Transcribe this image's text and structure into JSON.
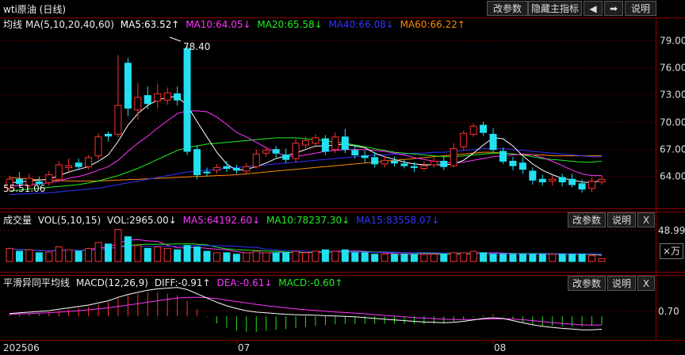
{
  "window": {
    "title": "wti原油 (日线)",
    "toolbar": {
      "params_label": "改参数",
      "hide_indicator_label": "隐藏主指标",
      "back_label": "◀",
      "forward_label": "➡",
      "help_label": "说明"
    }
  },
  "main_panel": {
    "legend": {
      "name": "均线",
      "config": "MA(5,10,20,40,60)",
      "ma5": "MA5:63.52↑",
      "ma10": "MA10:64.05↓",
      "ma20": "MA20:65.58↓",
      "ma40": "MA40:66.08↓",
      "ma60": "MA60:66.22↑"
    },
    "y_ticks": [
      "79.00",
      "76.00",
      "73.00",
      "70.00",
      "67.00",
      "64.00"
    ],
    "high_label": "78.40",
    "low_label": "55.51.06"
  },
  "volume_panel": {
    "legend": {
      "name": "成交量",
      "config": "VOL(5,10,15)",
      "vol": "VOL:2965.00↓",
      "ma5": "MA5:64192.60↓",
      "ma10": "MA10:78237.30↓",
      "ma15": "MA15:83558.07↓"
    },
    "params_label": "改参数",
    "help_label": "说明",
    "close_label": "X",
    "y_tick": "48.99",
    "unit_label": "×万"
  },
  "macd_panel": {
    "legend": {
      "name": "平滑异同平均线",
      "config": "MACD(12,26,9)",
      "diff": "DIFF:-0.91↑",
      "dea": "DEA:-0.61↓",
      "macd": "MACD:-0.60↑"
    },
    "params_label": "改参数",
    "help_label": "说明",
    "close_label": "X",
    "y_tick": "0.70"
  },
  "x_axis": {
    "labels": [
      "202506",
      "07",
      "08"
    ]
  },
  "colors": {
    "up": "#ff3030",
    "down": "#22e0f0",
    "ma5": "#ffffff",
    "ma10": "#ff33ff",
    "ma20": "#22ee22",
    "ma40": "#3333ff",
    "ma60": "#ff8800",
    "diff": "#ffffff",
    "dea": "#ff33ff",
    "macd_pos": "#ff3030",
    "macd_neg": "#22e022"
  },
  "chart_data": {
    "type": "candlestick",
    "y_range": [
      61.5,
      80.0
    ],
    "candles": [
      {
        "o": 62.6,
        "c": 63.6,
        "h": 64.0,
        "l": 62.2
      },
      {
        "o": 63.6,
        "c": 63.1,
        "h": 64.4,
        "l": 62.8
      },
      {
        "o": 62.9,
        "c": 63.7,
        "h": 64.2,
        "l": 62.5
      },
      {
        "o": 63.3,
        "c": 63.1,
        "h": 63.9,
        "l": 62.9
      },
      {
        "o": 63.2,
        "c": 64.1,
        "h": 64.5,
        "l": 62.9
      },
      {
        "o": 63.6,
        "c": 65.2,
        "h": 65.6,
        "l": 63.3
      },
      {
        "o": 64.9,
        "c": 65.1,
        "h": 65.9,
        "l": 64.4
      },
      {
        "o": 65.4,
        "c": 65.0,
        "h": 65.9,
        "l": 64.6
      },
      {
        "o": 65.0,
        "c": 66.0,
        "h": 66.3,
        "l": 64.7
      },
      {
        "o": 66.2,
        "c": 68.3,
        "h": 68.7,
        "l": 65.8
      },
      {
        "o": 68.6,
        "c": 68.4,
        "h": 68.9,
        "l": 67.8
      },
      {
        "o": 68.6,
        "c": 71.8,
        "h": 77.4,
        "l": 68.3
      },
      {
        "o": 76.5,
        "c": 71.5,
        "h": 77.1,
        "l": 70.6
      },
      {
        "o": 71.3,
        "c": 72.7,
        "h": 74.3,
        "l": 70.2
      },
      {
        "o": 72.9,
        "c": 72.0,
        "h": 73.9,
        "l": 71.4
      },
      {
        "o": 72.3,
        "c": 73.1,
        "h": 74.2,
        "l": 71.5
      },
      {
        "o": 72.4,
        "c": 73.2,
        "h": 73.8,
        "l": 71.9
      },
      {
        "o": 73.1,
        "c": 72.4,
        "h": 73.9,
        "l": 71.8
      },
      {
        "o": 78.1,
        "c": 66.7,
        "h": 78.4,
        "l": 66.3
      },
      {
        "o": 66.9,
        "c": 64.1,
        "h": 67.4,
        "l": 63.6
      },
      {
        "o": 64.4,
        "c": 64.3,
        "h": 64.9,
        "l": 63.9
      },
      {
        "o": 64.6,
        "c": 64.9,
        "h": 65.3,
        "l": 64.2
      },
      {
        "o": 65.0,
        "c": 64.8,
        "h": 65.6,
        "l": 64.4
      },
      {
        "o": 64.8,
        "c": 64.6,
        "h": 65.2,
        "l": 64.2
      },
      {
        "o": 64.5,
        "c": 65.0,
        "h": 65.4,
        "l": 64.2
      },
      {
        "o": 65.0,
        "c": 66.4,
        "h": 66.9,
        "l": 64.8
      },
      {
        "o": 66.5,
        "c": 66.8,
        "h": 67.2,
        "l": 66.1
      },
      {
        "o": 66.9,
        "c": 66.5,
        "h": 67.3,
        "l": 66.0
      },
      {
        "o": 66.3,
        "c": 65.8,
        "h": 67.0,
        "l": 65.4
      },
      {
        "o": 65.9,
        "c": 67.6,
        "h": 68.1,
        "l": 65.5
      },
      {
        "o": 67.4,
        "c": 67.9,
        "h": 68.3,
        "l": 67.0
      },
      {
        "o": 67.6,
        "c": 68.2,
        "h": 68.6,
        "l": 67.1
      },
      {
        "o": 68.1,
        "c": 66.7,
        "h": 68.5,
        "l": 66.3
      },
      {
        "o": 66.9,
        "c": 68.3,
        "h": 68.8,
        "l": 66.5
      },
      {
        "o": 68.3,
        "c": 66.9,
        "h": 69.2,
        "l": 66.5
      },
      {
        "o": 66.8,
        "c": 66.3,
        "h": 67.4,
        "l": 65.9
      },
      {
        "o": 66.2,
        "c": 66.0,
        "h": 66.8,
        "l": 65.4
      },
      {
        "o": 66.0,
        "c": 65.3,
        "h": 66.6,
        "l": 64.9
      },
      {
        "o": 65.3,
        "c": 65.7,
        "h": 66.2,
        "l": 64.9
      },
      {
        "o": 65.6,
        "c": 65.4,
        "h": 66.1,
        "l": 65.0
      },
      {
        "o": 65.3,
        "c": 65.1,
        "h": 65.8,
        "l": 64.8
      },
      {
        "o": 65.0,
        "c": 64.9,
        "h": 65.5,
        "l": 64.4
      },
      {
        "o": 64.8,
        "c": 65.1,
        "h": 65.6,
        "l": 64.5
      },
      {
        "o": 65.2,
        "c": 65.6,
        "h": 66.0,
        "l": 64.9
      },
      {
        "o": 65.6,
        "c": 65.0,
        "h": 66.1,
        "l": 64.6
      },
      {
        "o": 65.1,
        "c": 67.0,
        "h": 67.6,
        "l": 64.9
      },
      {
        "o": 67.2,
        "c": 68.7,
        "h": 69.0,
        "l": 66.8
      },
      {
        "o": 68.6,
        "c": 69.5,
        "h": 69.8,
        "l": 68.3
      },
      {
        "o": 69.6,
        "c": 68.8,
        "h": 70.0,
        "l": 68.4
      },
      {
        "o": 68.6,
        "c": 66.9,
        "h": 69.3,
        "l": 66.5
      },
      {
        "o": 66.7,
        "c": 65.6,
        "h": 67.1,
        "l": 65.3
      },
      {
        "o": 65.6,
        "c": 65.1,
        "h": 66.1,
        "l": 64.6
      },
      {
        "o": 65.4,
        "c": 64.7,
        "h": 66.0,
        "l": 64.2
      },
      {
        "o": 64.5,
        "c": 63.5,
        "h": 64.9,
        "l": 63.0
      },
      {
        "o": 63.6,
        "c": 63.3,
        "h": 64.1,
        "l": 62.9
      },
      {
        "o": 63.4,
        "c": 63.6,
        "h": 64.0,
        "l": 62.9
      },
      {
        "o": 63.8,
        "c": 63.3,
        "h": 64.2,
        "l": 62.8
      },
      {
        "o": 63.6,
        "c": 63.0,
        "h": 64.2,
        "l": 62.7
      },
      {
        "o": 63.1,
        "c": 62.5,
        "h": 63.6,
        "l": 62.1
      },
      {
        "o": 62.6,
        "c": 63.4,
        "h": 63.8,
        "l": 62.2
      },
      {
        "o": 63.3,
        "c": 63.6,
        "h": 64.0,
        "l": 63.0
      }
    ],
    "ma_lines": {
      "ma5": [
        63.2,
        63.3,
        63.4,
        63.5,
        63.6,
        64.0,
        64.4,
        64.7,
        65.0,
        65.6,
        66.3,
        67.8,
        69.6,
        70.9,
        71.8,
        72.4,
        72.7,
        72.8,
        71.8,
        70.0,
        68.3,
        66.6,
        65.3,
        64.6,
        64.7,
        65.0,
        65.4,
        65.9,
        66.2,
        66.5,
        66.9,
        67.3,
        67.3,
        67.4,
        67.5,
        67.3,
        67.1,
        66.5,
        66.1,
        65.8,
        65.5,
        65.3,
        65.2,
        65.2,
        65.2,
        65.3,
        65.7,
        66.5,
        67.4,
        68.2,
        68.1,
        67.3,
        66.2,
        65.3,
        64.6,
        64.1,
        63.7,
        63.5,
        63.3,
        63.2,
        63.5
      ],
      "ma10": [
        62.8,
        62.9,
        63.0,
        63.1,
        63.2,
        63.4,
        63.7,
        63.9,
        64.2,
        64.6,
        65.0,
        65.7,
        66.7,
        67.6,
        68.4,
        69.3,
        70.1,
        70.9,
        71.2,
        71.2,
        71.1,
        70.5,
        69.7,
        68.8,
        68.3,
        67.7,
        67.1,
        66.6,
        66.2,
        66.1,
        66.3,
        66.5,
        66.7,
        66.8,
        66.9,
        66.9,
        66.9,
        66.8,
        66.7,
        66.5,
        66.3,
        66.0,
        65.8,
        65.6,
        65.5,
        65.4,
        65.5,
        65.7,
        65.9,
        66.1,
        66.2,
        66.3,
        66.4,
        66.3,
        66.0,
        65.6,
        65.1,
        64.6,
        64.2,
        64.0,
        64.0
      ],
      "ma20": [
        62.3,
        62.4,
        62.5,
        62.6,
        62.7,
        62.8,
        62.9,
        63.0,
        63.2,
        63.4,
        63.7,
        64.0,
        64.4,
        64.8,
        65.3,
        65.8,
        66.3,
        66.8,
        67.1,
        67.3,
        67.5,
        67.6,
        67.7,
        67.8,
        67.9,
        68.0,
        68.1,
        68.2,
        68.2,
        68.2,
        68.1,
        68.0,
        67.9,
        67.7,
        67.6,
        67.4,
        67.2,
        67.0,
        66.8,
        66.6,
        66.5,
        66.4,
        66.3,
        66.2,
        66.1,
        66.1,
        66.2,
        66.3,
        66.4,
        66.5,
        66.5,
        66.4,
        66.3,
        66.1,
        65.9,
        65.8,
        65.7,
        65.6,
        65.5,
        65.5,
        65.6
      ],
      "ma40": [
        61.9,
        61.95,
        62.0,
        62.05,
        62.1,
        62.2,
        62.3,
        62.4,
        62.5,
        62.6,
        62.8,
        63.0,
        63.2,
        63.4,
        63.6,
        63.8,
        64.0,
        64.2,
        64.4,
        64.5,
        64.6,
        64.7,
        64.8,
        64.9,
        65.0,
        65.1,
        65.2,
        65.3,
        65.4,
        65.5,
        65.6,
        65.7,
        65.8,
        65.9,
        66.0,
        66.1,
        66.2,
        66.3,
        66.3,
        66.4,
        66.4,
        66.5,
        66.5,
        66.6,
        66.6,
        66.7,
        66.8,
        66.9,
        67.0,
        67.0,
        67.0,
        66.9,
        66.8,
        66.7,
        66.6,
        66.5,
        66.4,
        66.3,
        66.2,
        66.1,
        66.1
      ],
      "ma60": [
        63.8,
        63.7,
        63.6,
        63.55,
        63.5,
        63.45,
        63.4,
        63.4,
        63.4,
        63.4,
        63.45,
        63.5,
        63.55,
        63.6,
        63.65,
        63.7,
        63.75,
        63.8,
        63.85,
        63.9,
        63.95,
        64.0,
        64.05,
        64.1,
        64.2,
        64.3,
        64.4,
        64.5,
        64.6,
        64.7,
        64.8,
        64.9,
        65.0,
        65.1,
        65.2,
        65.3,
        65.4,
        65.5,
        65.6,
        65.7,
        65.8,
        65.9,
        66.0,
        66.1,
        66.2,
        66.3,
        66.4,
        66.5,
        66.6,
        66.6,
        66.5,
        66.4,
        66.3,
        66.3,
        66.3,
        66.2,
        66.2,
        66.2,
        66.2,
        66.2,
        66.2
      ]
    },
    "volume": [
      18,
      14,
      16,
      12,
      13,
      20,
      16,
      14,
      18,
      26,
      24,
      44,
      34,
      22,
      18,
      20,
      18,
      16,
      22,
      20,
      14,
      12,
      12,
      10,
      12,
      14,
      12,
      12,
      12,
      14,
      12,
      14,
      16,
      14,
      16,
      12,
      12,
      10,
      10,
      10,
      10,
      10,
      10,
      10,
      10,
      12,
      12,
      14,
      12,
      10,
      10,
      10,
      10,
      10,
      10,
      10,
      10,
      10,
      10,
      8,
      4
    ],
    "volume_range": [
      0,
      50
    ],
    "macd": {
      "range": [
        -1.5,
        2.2
      ],
      "diff": [
        0.2,
        0.25,
        0.3,
        0.35,
        0.4,
        0.5,
        0.6,
        0.7,
        0.8,
        0.95,
        1.1,
        1.35,
        1.55,
        1.7,
        1.85,
        1.95,
        2.0,
        2.05,
        1.9,
        1.6,
        1.3,
        1.0,
        0.75,
        0.55,
        0.4,
        0.3,
        0.25,
        0.2,
        0.15,
        0.12,
        0.1,
        0.08,
        0.05,
        0.03,
        0.0,
        -0.03,
        -0.08,
        -0.15,
        -0.2,
        -0.25,
        -0.3,
        -0.35,
        -0.4,
        -0.42,
        -0.45,
        -0.42,
        -0.35,
        -0.25,
        -0.15,
        -0.1,
        -0.15,
        -0.3,
        -0.45,
        -0.6,
        -0.7,
        -0.78,
        -0.85,
        -0.9,
        -0.95,
        -0.95,
        -0.91
      ],
      "dea": [
        0.15,
        0.18,
        0.2,
        0.23,
        0.26,
        0.3,
        0.35,
        0.4,
        0.46,
        0.53,
        0.6,
        0.7,
        0.8,
        0.9,
        1.0,
        1.1,
        1.2,
        1.3,
        1.35,
        1.35,
        1.32,
        1.25,
        1.15,
        1.05,
        0.95,
        0.85,
        0.76,
        0.68,
        0.6,
        0.53,
        0.47,
        0.41,
        0.36,
        0.31,
        0.27,
        0.23,
        0.18,
        0.12,
        0.07,
        0.02,
        -0.03,
        -0.08,
        -0.12,
        -0.16,
        -0.2,
        -0.22,
        -0.23,
        -0.22,
        -0.2,
        -0.18,
        -0.17,
        -0.19,
        -0.24,
        -0.3,
        -0.37,
        -0.44,
        -0.5,
        -0.55,
        -0.6,
        -0.62,
        -0.61
      ],
      "macd_bar": [
        0.1,
        0.14,
        0.2,
        0.24,
        0.28,
        0.4,
        0.5,
        0.6,
        0.68,
        0.84,
        1.0,
        1.3,
        1.5,
        1.6,
        1.7,
        1.7,
        1.6,
        1.5,
        1.1,
        0.5,
        -0.04,
        -0.5,
        -0.8,
        -1.0,
        -1.1,
        -1.1,
        -1.02,
        -0.96,
        -0.9,
        -0.82,
        -0.74,
        -0.66,
        -0.62,
        -0.56,
        -0.54,
        -0.52,
        -0.52,
        -0.54,
        -0.54,
        -0.54,
        -0.54,
        -0.54,
        -0.56,
        -0.52,
        -0.5,
        -0.4,
        -0.24,
        -0.06,
        0.1,
        0.16,
        0.04,
        -0.22,
        -0.42,
        -0.6,
        -0.66,
        -0.68,
        -0.7,
        -0.7,
        -0.7,
        -0.66,
        -0.6
      ]
    }
  }
}
